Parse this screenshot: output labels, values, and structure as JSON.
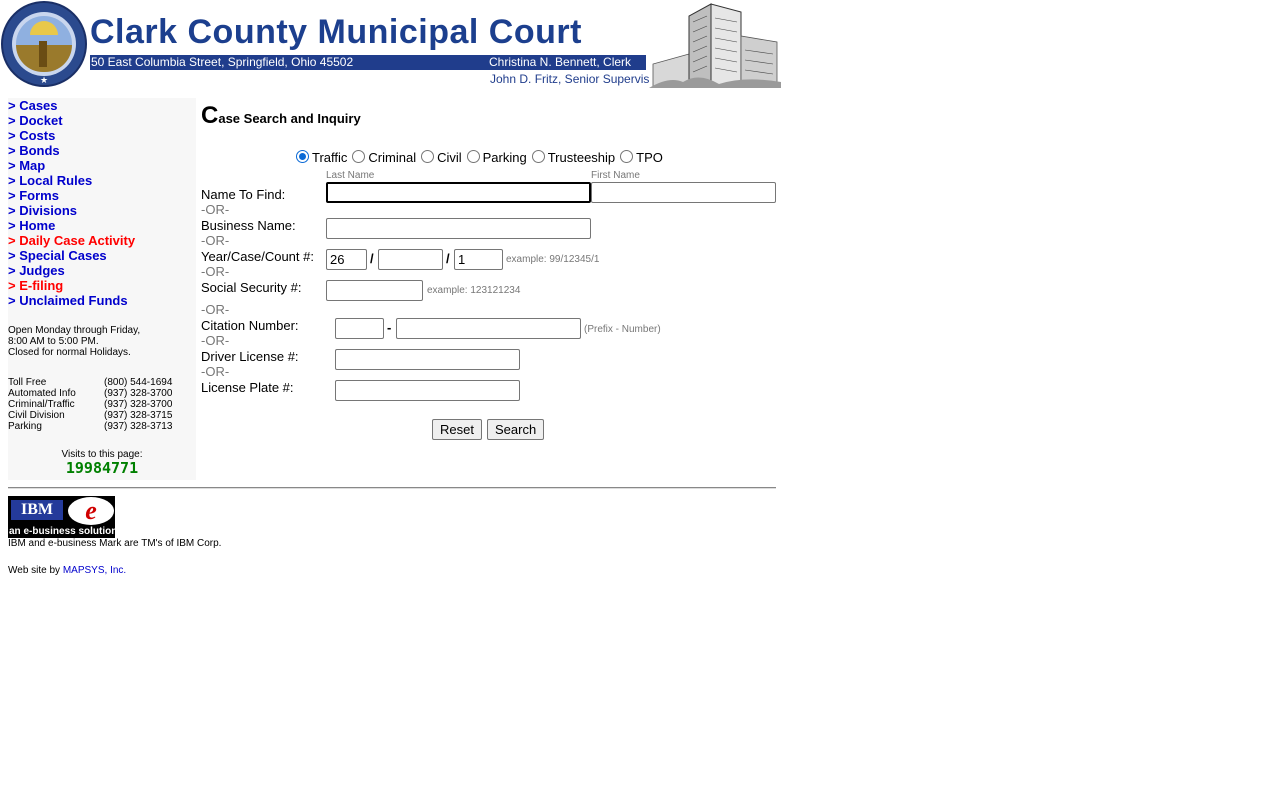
{
  "header": {
    "title": "Clark County Municipal Court",
    "address": "50 East Columbia Street, Springfield, Ohio 45502",
    "clerk": "Christina N. Bennett, Clerk",
    "supervisor": "John D. Fritz, Senior Supervisor",
    "seal_text": "THE GREAT SEAL OF THE STATE OF OHIO"
  },
  "sidebar": {
    "nav": [
      {
        "label": "> Cases",
        "color": "#0000cc"
      },
      {
        "label": "> Docket",
        "color": "#0000cc"
      },
      {
        "label": "> Costs",
        "color": "#0000cc"
      },
      {
        "label": "> Bonds",
        "color": "#0000cc"
      },
      {
        "label": "> Map",
        "color": "#0000cc"
      },
      {
        "label": "> Local Rules",
        "color": "#0000cc"
      },
      {
        "label": "> Forms",
        "color": "#0000cc"
      },
      {
        "label": "> Divisions",
        "color": "#0000cc"
      },
      {
        "label": "> Home",
        "color": "#0000cc"
      },
      {
        "label": "> Daily Case Activity",
        "color": "#ff0000"
      },
      {
        "label": "> Special Cases",
        "color": "#0000cc"
      },
      {
        "label": "> Judges",
        "color": "#0000cc"
      },
      {
        "label": "> E-filing",
        "color": "#ff0000"
      },
      {
        "label": "> Unclaimed Funds",
        "color": "#0000cc"
      }
    ],
    "hours": [
      "Open Monday through Friday,",
      "8:00 AM to 5:00 PM.",
      "Closed for normal Holidays."
    ],
    "phones": [
      {
        "label": "Toll Free",
        "number": "(800) 544-1694"
      },
      {
        "label": "Automated Info",
        "number": "(937) 328-3700"
      },
      {
        "label": "Criminal/Traffic",
        "number": "(937) 328-3700"
      },
      {
        "label": "Civil Division",
        "number": "(937) 328-3715"
      },
      {
        "label": "Parking",
        "number": "(937) 328-3713"
      }
    ],
    "visits_label": "Visits to this page:",
    "visits_count": "19984771"
  },
  "form": {
    "title_first_letter": "C",
    "title_rest": "ase Search and Inquiry",
    "case_types": [
      {
        "label": "Traffic",
        "selected": true
      },
      {
        "label": "Criminal",
        "selected": false
      },
      {
        "label": "Civil",
        "selected": false
      },
      {
        "label": "Parking",
        "selected": false
      },
      {
        "label": "Trusteeship",
        "selected": false
      },
      {
        "label": "TPO",
        "selected": false
      }
    ],
    "last_name_hint": "Last Name",
    "first_name_hint": "First Name",
    "or_text": "-OR-",
    "name_label": "Name To Find:",
    "last_name_value": "",
    "first_name_value": "",
    "business_label": "Business Name:",
    "business_value": "",
    "ycc_label": "Year/Case/Count #:",
    "year_value": "26",
    "case_value": "",
    "count_value": "1",
    "slash": "/",
    "ycc_example": "example: 99/12345/1",
    "ssn_label": "Social Security #:",
    "ssn_value": "",
    "ssn_example": "example: 123121234",
    "citation_label": "Citation Number:",
    "citation_prefix_value": "",
    "citation_number_value": "",
    "dash": "-",
    "citation_example": "(Prefix - Number)",
    "driver_label": "Driver License #:",
    "driver_value": "",
    "plate_label": "License Plate #:",
    "plate_value": "",
    "reset_label": "Reset",
    "search_label": "Search"
  },
  "footer": {
    "ibm_box": "IBM",
    "ibm_e": "e",
    "ibm_tagline": "an e-business solution",
    "tm_note": "IBM and e-business Mark are TM's of IBM Corp.",
    "credit_prefix": "Web site by ",
    "credit_link": "MAPSYS, Inc."
  },
  "icons": {
    "seal": "ohio-seal-icon",
    "building": "courthouse-building-icon"
  }
}
